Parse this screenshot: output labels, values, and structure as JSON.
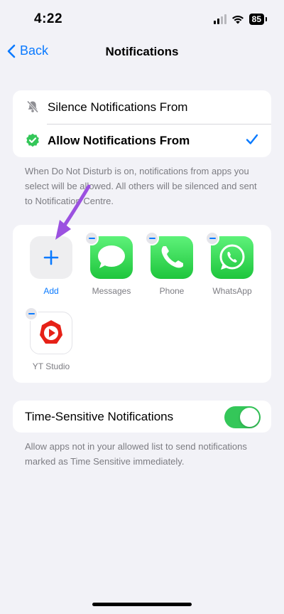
{
  "status": {
    "time": "4:22",
    "battery": "85"
  },
  "nav": {
    "back_label": "Back",
    "title": "Notifications"
  },
  "mode_options": [
    {
      "label": "Silence Notifications From",
      "icon": "bell-slash-icon",
      "selected": false
    },
    {
      "label": "Allow Notifications From",
      "icon": "verified-check-badge-icon",
      "selected": true
    }
  ],
  "mode_footnote": "When Do Not Disturb is on, notifications from apps you select will be allowed. All others will be silenced and sent to Notification Centre.",
  "apps": {
    "add_label": "Add",
    "items": [
      {
        "label": "Messages",
        "icon": "messages-app-icon"
      },
      {
        "label": "Phone",
        "icon": "phone-app-icon"
      },
      {
        "label": "WhatsApp",
        "icon": "whatsapp-app-icon"
      },
      {
        "label": "YT Studio",
        "icon": "yt-studio-app-icon"
      }
    ]
  },
  "time_sensitive": {
    "label": "Time-Sensitive Notifications",
    "enabled": true,
    "footnote": "Allow apps not in your allowed list to send notifications marked as Time Sensitive immediately."
  },
  "colors": {
    "accent": "#0a7aff",
    "toggle_on": "#34c759",
    "annotation_arrow": "#9b51e0",
    "background": "#f2f2f7"
  }
}
